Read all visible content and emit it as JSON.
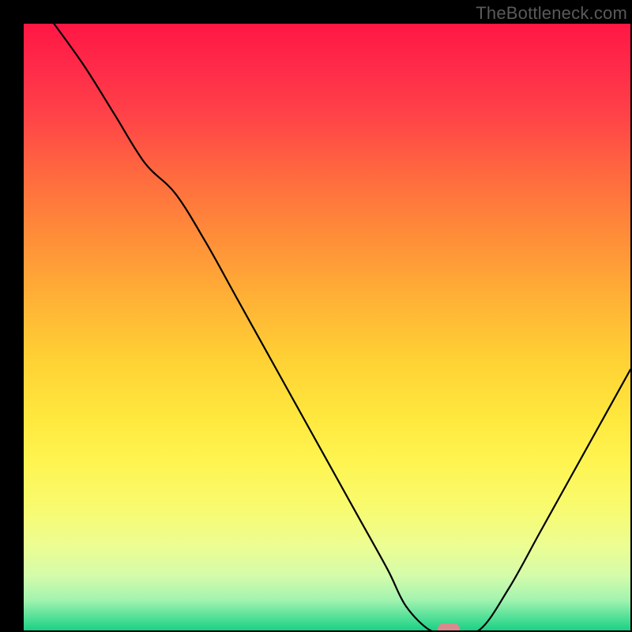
{
  "attribution": "TheBottleneck.com",
  "chart_data": {
    "type": "line",
    "title": "",
    "xlabel": "",
    "ylabel": "",
    "xlim": [
      0,
      100
    ],
    "ylim": [
      0,
      100
    ],
    "series": [
      {
        "name": "bottleneck-curve",
        "x": [
          5,
          10,
          15,
          20,
          25,
          30,
          35,
          40,
          45,
          50,
          55,
          60,
          63,
          67,
          70,
          75,
          80,
          85,
          90,
          95,
          100
        ],
        "y": [
          100,
          93,
          85,
          77,
          72,
          64,
          55,
          46,
          37,
          28,
          19,
          10,
          4,
          0,
          0,
          0,
          7,
          16,
          25,
          34,
          43
        ]
      }
    ],
    "marker": {
      "x": 70,
      "y": 0
    },
    "gradient": {
      "stops": [
        {
          "offset": 0.0,
          "color": "#ff1744"
        },
        {
          "offset": 0.07,
          "color": "#ff2a49"
        },
        {
          "offset": 0.15,
          "color": "#ff4248"
        },
        {
          "offset": 0.25,
          "color": "#ff6a3f"
        },
        {
          "offset": 0.35,
          "color": "#ff8d39"
        },
        {
          "offset": 0.45,
          "color": "#ffb036"
        },
        {
          "offset": 0.55,
          "color": "#ffd034"
        },
        {
          "offset": 0.65,
          "color": "#ffe83e"
        },
        {
          "offset": 0.72,
          "color": "#fff450"
        },
        {
          "offset": 0.8,
          "color": "#f8fb70"
        },
        {
          "offset": 0.86,
          "color": "#ecfd92"
        },
        {
          "offset": 0.91,
          "color": "#d4fcaa"
        },
        {
          "offset": 0.95,
          "color": "#a2f3b0"
        },
        {
          "offset": 0.975,
          "color": "#5de29b"
        },
        {
          "offset": 1.0,
          "color": "#19d184"
        }
      ]
    }
  }
}
